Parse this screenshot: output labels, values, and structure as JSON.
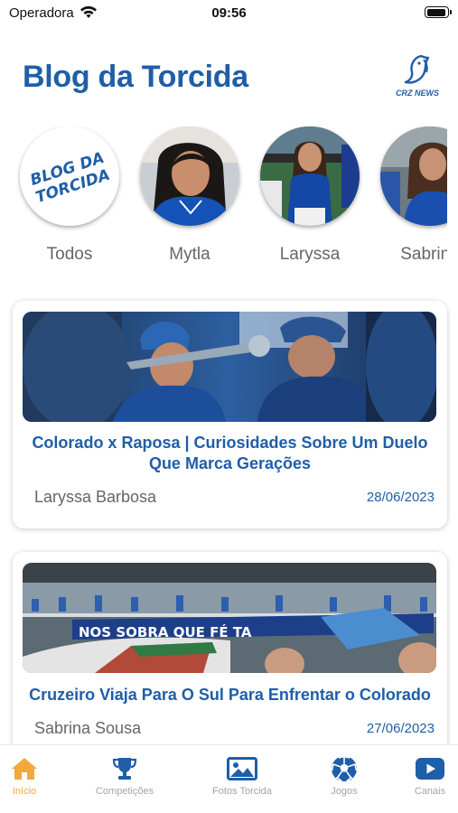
{
  "status_bar": {
    "carrier": "Operadora",
    "time": "09:56",
    "battery_level": 0.95
  },
  "header": {
    "title": "Blog da Torcida",
    "logo_text": "CRZ NEWS"
  },
  "stories": [
    {
      "name": "Todos",
      "avatar_text_line1": "BLOG DA",
      "avatar_text_line2": "TORCIDA"
    },
    {
      "name": "Mytla"
    },
    {
      "name": "Laryssa"
    },
    {
      "name": "Sabrina"
    }
  ],
  "posts": [
    {
      "title": "Colorado x Raposa | Curiosidades Sobre Um Duelo Que Marca Gerações",
      "author": "Laryssa Barbosa",
      "date": "28/06/2023"
    },
    {
      "title": "Cruzeiro Viaja Para O Sul Para Enfrentar o Colorado",
      "author": "Sabrina Sousa",
      "date": "27/06/2023",
      "banner_text": "NOS SOBRA QUE FÉ TA"
    }
  ],
  "tabs": [
    {
      "label": "Início",
      "icon": "home-icon",
      "active": true
    },
    {
      "label": "Competições",
      "icon": "trophy-icon",
      "active": false
    },
    {
      "label": "Fotos Torcida",
      "icon": "photo-icon",
      "active": false
    },
    {
      "label": "Jogos",
      "icon": "soccer-ball-icon",
      "active": false
    },
    {
      "label": "Canais",
      "icon": "youtube-icon",
      "active": false
    }
  ],
  "colors": {
    "accent": "#1f5ea8",
    "active_tab": "#f2a93b",
    "inactive_tab": "#a4a4a4"
  }
}
